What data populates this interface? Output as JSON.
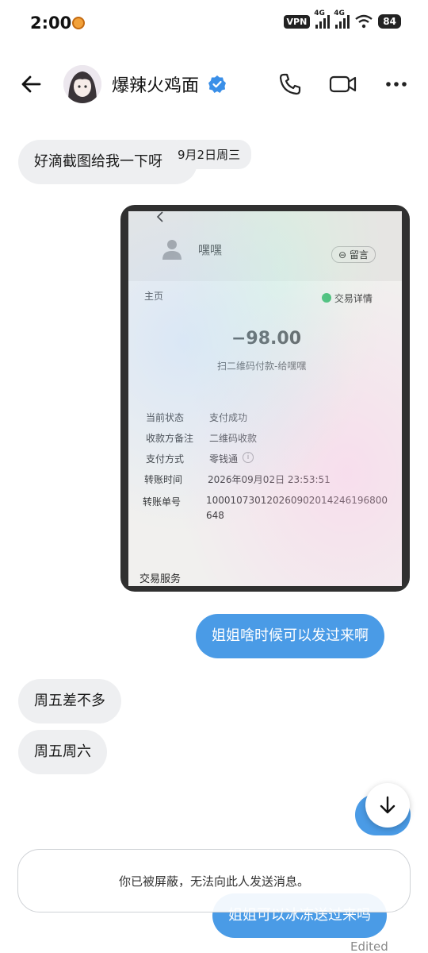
{
  "status_bar": {
    "time": "2:00",
    "vpn": "VPN",
    "network1": "4G",
    "network2": "4G",
    "battery": "84"
  },
  "header": {
    "contact_name": "爆辣火鸡面"
  },
  "messages": {
    "m1": "好滴截图给我一下呀",
    "date": "9月2日周三",
    "m2": "姐姐啥时候可以发过来啊",
    "m3": "周五差不多",
    "m4": "周五周六",
    "m5": "姐姐可以冰冻送过来吗",
    "edited": "Edited"
  },
  "photo": {
    "payee": "嘿嘿",
    "leave_msg": "留言",
    "home": "主页",
    "details": "交易详情",
    "amount": "−98.00",
    "subtitle": "扫二维码付款-给嘿嘿",
    "rows": [
      {
        "label": "当前状态",
        "value": "支付成功"
      },
      {
        "label": "收款方备注",
        "value": "二维码收款"
      },
      {
        "label": "支付方式",
        "value": "零钱通"
      },
      {
        "label": "转账时间",
        "value": "2026年09月02日 23:53:51"
      },
      {
        "label": "转账单号",
        "value": "100010730120260902014246196800"
      },
      {
        "value2": "648"
      }
    ],
    "service": "交易服务"
  },
  "blocked_notice": "你已被屏蔽，无法向此人发送消息。",
  "colors": {
    "outgoing_bubble": "#4a9be6",
    "incoming_bubble": "#eeeff1",
    "verified": "#3a8fe8"
  }
}
